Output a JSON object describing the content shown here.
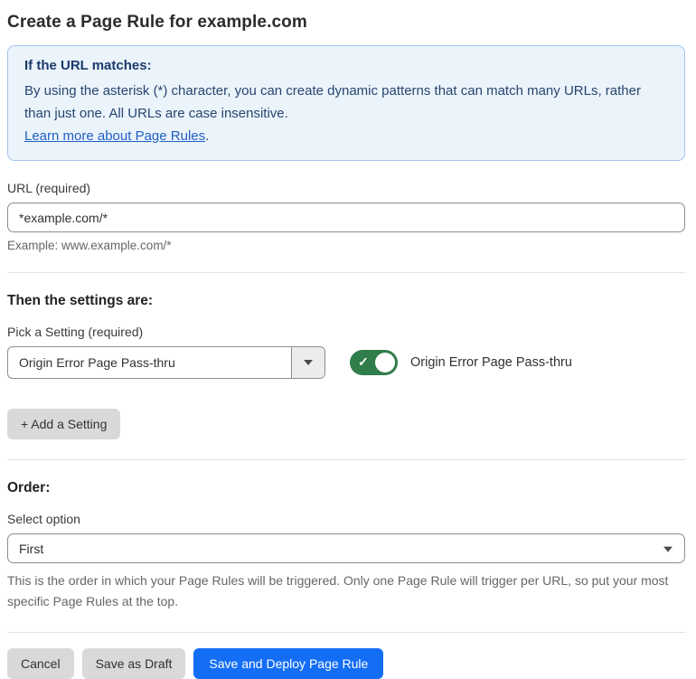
{
  "page": {
    "title": "Create a Page Rule for example.com"
  },
  "info_box": {
    "heading": "If the URL matches:",
    "body": "By using the asterisk (*) character, you can create dynamic patterns that can match many URLs, rather than just one. All URLs are case insensitive.",
    "link_label": "Learn more about Page Rules",
    "link_suffix": "."
  },
  "url_section": {
    "label": "URL (required)",
    "value": "*example.com/*",
    "helper": "Example: www.example.com/*"
  },
  "settings_section": {
    "heading": "Then the settings are:",
    "picker_label": "Pick a Setting (required)",
    "picker_value": "Origin Error Page Pass-thru",
    "toggle_state": "on",
    "toggle_check_glyph": "✓",
    "toggle_label": "Origin Error Page Pass-thru",
    "add_setting_label": "+ Add a Setting"
  },
  "order_section": {
    "heading": "Order:",
    "select_label": "Select option",
    "select_value": "First",
    "helper": "This is the order in which your Page Rules will be triggered. Only one Page Rule will trigger per URL, so put your most specific Page Rules at the top."
  },
  "footer": {
    "cancel_label": "Cancel",
    "save_draft_label": "Save as Draft",
    "save_deploy_label": "Save and Deploy Page Rule"
  },
  "colors": {
    "accent_blue": "#146ef5",
    "toggle_green": "#2f7d4a",
    "info_bg": "#ebf3fb",
    "info_border": "#a3c6ea",
    "info_heading": "#1b3a6b",
    "info_text": "#27466f",
    "link_blue": "#2160c4"
  }
}
